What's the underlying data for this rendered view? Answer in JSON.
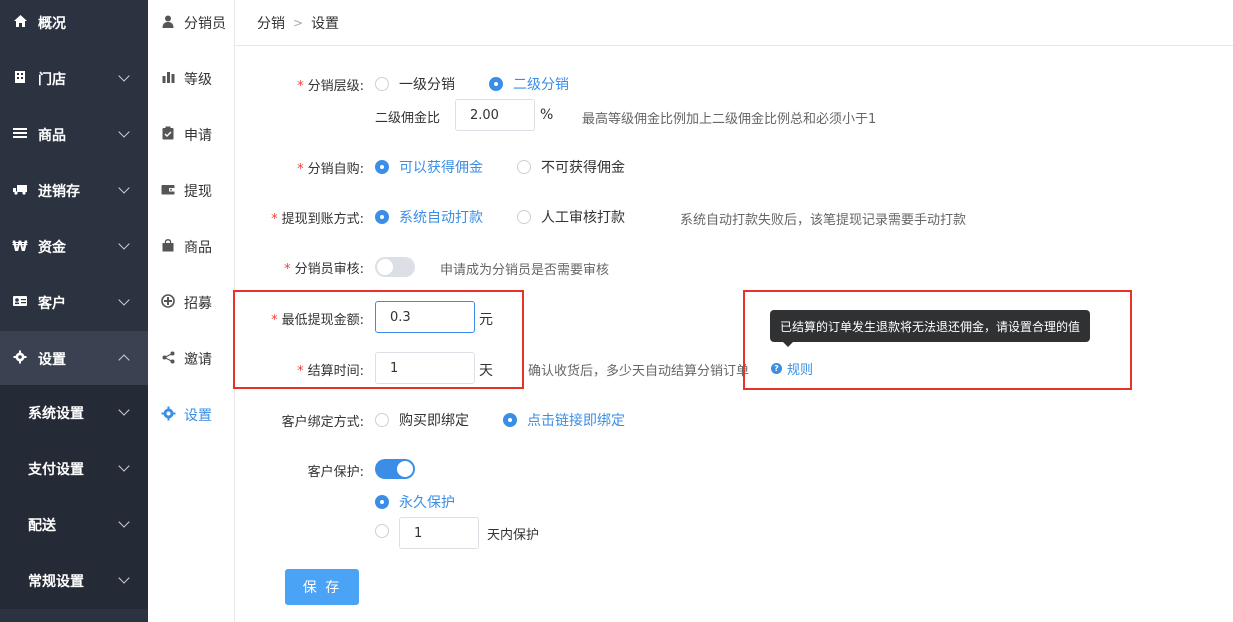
{
  "sidebar": {
    "items": [
      {
        "label": "概况",
        "icon": "home-icon"
      },
      {
        "label": "门店",
        "icon": "building-icon"
      },
      {
        "label": "商品",
        "icon": "list-icon"
      },
      {
        "label": "进销存",
        "icon": "truck-icon"
      },
      {
        "label": "资金",
        "icon": "won-icon"
      },
      {
        "label": "客户",
        "icon": "id-card-icon"
      },
      {
        "label": "设置",
        "icon": "gear-icon"
      }
    ],
    "subitems": [
      {
        "label": "系统设置"
      },
      {
        "label": "支付设置"
      },
      {
        "label": "配送"
      },
      {
        "label": "常规设置"
      }
    ]
  },
  "subnav": {
    "items": [
      {
        "label": "分销员",
        "icon": "user-icon"
      },
      {
        "label": "等级",
        "icon": "bar-chart-icon"
      },
      {
        "label": "申请",
        "icon": "clipboard-icon"
      },
      {
        "label": "提现",
        "icon": "wallet-icon"
      },
      {
        "label": "商品",
        "icon": "bag-icon"
      },
      {
        "label": "招募",
        "icon": "recruit-icon"
      },
      {
        "label": "邀请",
        "icon": "share-icon"
      },
      {
        "label": "设置",
        "icon": "gear-icon"
      }
    ]
  },
  "breadcrumb": {
    "parent": "分销",
    "current": "设置"
  },
  "form": {
    "level": {
      "label": "分销层级:",
      "opt1": "一级分销",
      "opt2": "二级分销",
      "ratio_label": "二级佣金比",
      "ratio_value": "2.00",
      "ratio_unit": "%",
      "ratio_hint": "最高等级佣金比例加上二级佣金比例总和必须小于1"
    },
    "self_buy": {
      "label": "分销自购:",
      "opt1": "可以获得佣金",
      "opt2": "不可获得佣金"
    },
    "withdraw": {
      "label": "提现到账方式:",
      "opt1": "系统自动打款",
      "opt2": "人工审核打款",
      "hint": "系统自动打款失败后，该笔提现记录需要手动打款"
    },
    "review": {
      "label": "分销员审核:",
      "hint": "申请成为分销员是否需要审核",
      "enabled": false
    },
    "min_withdraw": {
      "label": "最低提现金额:",
      "value": "0.3",
      "unit": "元"
    },
    "settle": {
      "label": "结算时间:",
      "value": "1",
      "unit": "天",
      "hint": "确认收货后，多少天自动结算分销订单",
      "rule_link": "规则"
    },
    "tooltip": "已结算的订单发生退款将无法退还佣金，请设置合理的值",
    "bind": {
      "label": "客户绑定方式:",
      "opt1": "购买即绑定",
      "opt2": "点击链接即绑定"
    },
    "protect": {
      "label": "客户保护:",
      "enabled": true,
      "opt1": "永久保护",
      "days_value": "1",
      "days_suffix": "天内保护"
    },
    "save": "保 存"
  }
}
